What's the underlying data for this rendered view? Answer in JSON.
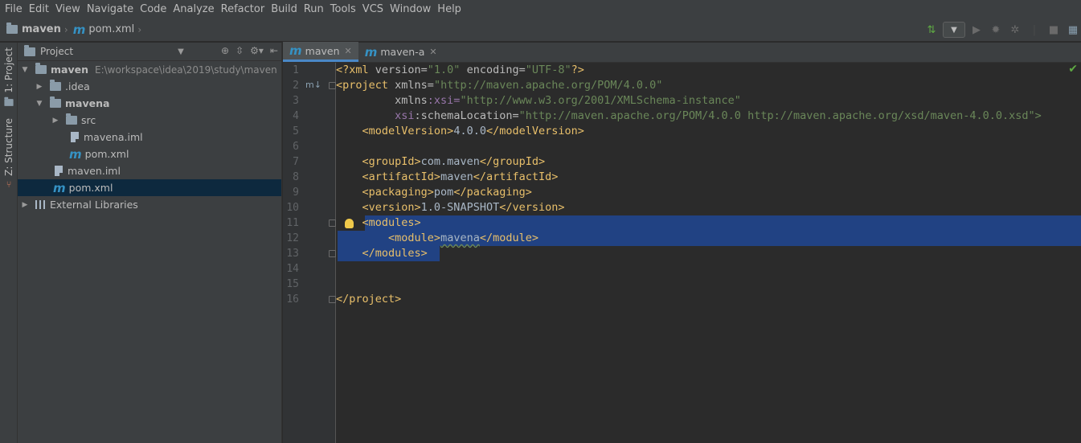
{
  "menu": [
    "File",
    "Edit",
    "View",
    "Navigate",
    "Code",
    "Analyze",
    "Refactor",
    "Build",
    "Run",
    "Tools",
    "VCS",
    "Window",
    "Help"
  ],
  "breadcrumb": {
    "project": "maven",
    "file": "pom.xml"
  },
  "stripe": {
    "project_tab": "1: Project",
    "structure_tab": "Z: Structure"
  },
  "project_panel": {
    "title": "Project",
    "tree": [
      {
        "label": "maven",
        "hint": "E:\\workspace\\idea\\2019\\study\\maven"
      },
      {
        "label": ".idea"
      },
      {
        "label": "mavena"
      },
      {
        "label": "src"
      },
      {
        "label": "mavena.iml"
      },
      {
        "label": "pom.xml"
      },
      {
        "label": "maven.iml"
      },
      {
        "label": "pom.xml"
      },
      {
        "label": "External Libraries"
      }
    ]
  },
  "editor_tabs": [
    {
      "label": "maven"
    },
    {
      "label": "maven-a"
    }
  ],
  "line_numbers": [
    "1",
    "2",
    "3",
    "4",
    "5",
    "6",
    "7",
    "8",
    "9",
    "10",
    "11",
    "12",
    "13",
    "14",
    "15",
    "16"
  ],
  "code": {
    "l1": {
      "pi_open": "<?xml",
      "a1": " version=",
      "v1": "\"1.0\"",
      "a2": " encoding=",
      "v2": "\"UTF-8\"",
      "pi_close": "?>"
    },
    "l2": {
      "open": "<project",
      "attr": " xmlns=",
      "val": "\"http://maven.apache.org/POM/4.0.0\""
    },
    "l3": {
      "indent": "         ",
      "ns": "xmlns",
      "attr": ":xsi=",
      "val": "\"http://www.w3.org/2001/XMLSchema-instance\""
    },
    "l4": {
      "indent": "         ",
      "ns": "xsi",
      "attr": ":schemaLocation=",
      "val": "\"http://maven.apache.org/POM/4.0.0 http://maven.apache.org/xsd/maven-4.0.0.xsd\">"
    },
    "l5": {
      "indent": "    ",
      "open": "<modelVersion>",
      "text": "4.0.0",
      "close": "</modelVersion>"
    },
    "l7": {
      "indent": "    ",
      "open": "<groupId>",
      "text": "com.maven",
      "close": "</groupId>"
    },
    "l8": {
      "indent": "    ",
      "open": "<artifactId>",
      "text": "maven",
      "close": "</artifactId>"
    },
    "l9": {
      "indent": "    ",
      "open": "<packaging>",
      "text": "pom",
      "close": "</packaging>"
    },
    "l10": {
      "indent": "    ",
      "open": "<version>",
      "text": "1.0-SNAPSHOT",
      "close": "</version>"
    },
    "l11": {
      "indent": "    ",
      "open": "<modules>"
    },
    "l12": {
      "indent": "        ",
      "open": "<module>",
      "text": "mavena",
      "close": "</module>"
    },
    "l13": {
      "indent": "    ",
      "close": "</modules>"
    },
    "l16": {
      "close": "</project>"
    }
  },
  "colors": {
    "selection": "#214283",
    "tag": "#e8bf6a",
    "value": "#6a8759",
    "namespace": "#9876aa",
    "accent": "#4a88c7"
  }
}
